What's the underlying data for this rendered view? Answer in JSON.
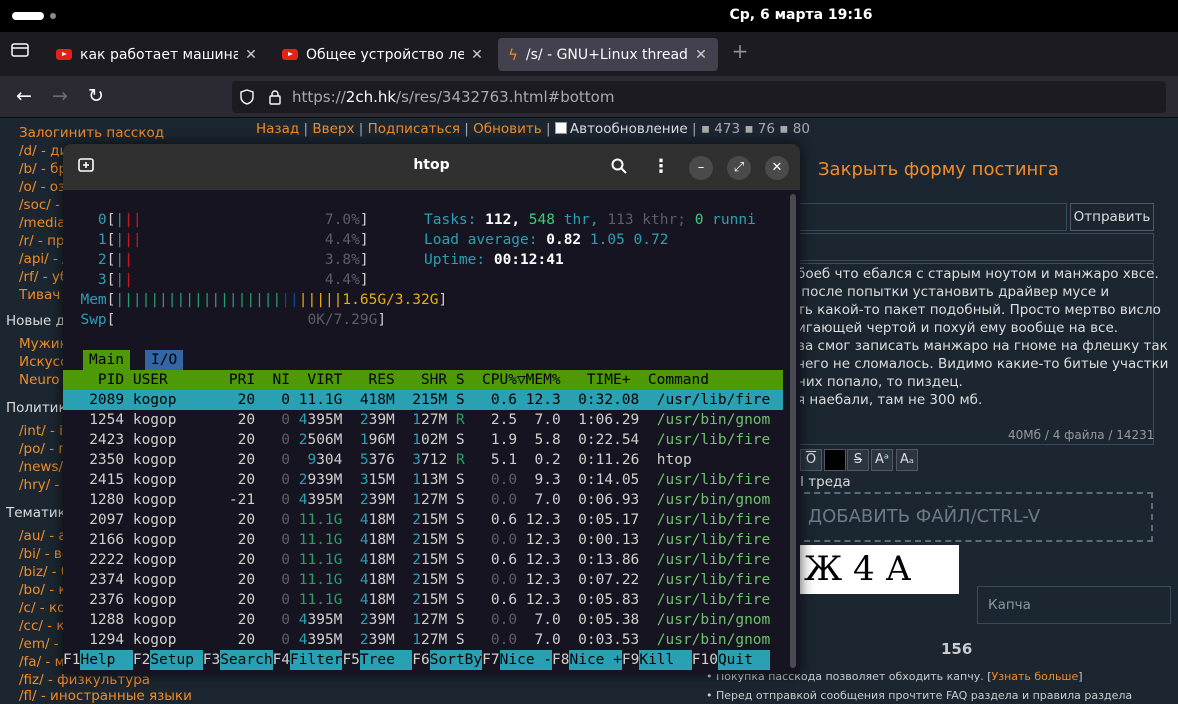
{
  "system": {
    "clock": "Ср, 6 марта  19:16"
  },
  "browser": {
    "tabs": [
      {
        "title": "как работает машина - "
      },
      {
        "title": "Общее устройство легк"
      },
      {
        "title": "/s/ - GNU+Linux thread #"
      }
    ],
    "url_scheme": "https://",
    "url_host": "2ch.hk",
    "url_path": "/s/res/3432763.html#bottom",
    "new_tab": "+"
  },
  "page": {
    "sidebar": [
      "Залогинить пасскод",
      "/d/ - ди",
      "/b/ - бр",
      "/o/ - оз",
      "/soc/ -",
      "/media",
      "/r/ - пр",
      "/api/ - /",
      "/rf/ - уб",
      "Тивач"
    ],
    "sections": [
      "Новые д",
      "Политик",
      "Тематик"
    ],
    "sidebar2": [
      "Мужик",
      "Искусс",
      "Neuro"
    ],
    "sidebar3": [
      "/int/ - i",
      "/po/ - п",
      "/news/",
      "/hry/ -"
    ],
    "sidebar4": [
      "/au/ - а",
      "/bi/ - ве",
      "/biz/ - б",
      "/bo/ - кн",
      "/c/ - ко",
      "/cc/ - к",
      "/em/ - ",
      "/fa/ - м",
      "/fiz/ - физкультура",
      "/fl/ - иностранные языки"
    ],
    "threadnav": {
      "back": "Назад",
      "up": "Вверх",
      "subscribe": "Подписаться",
      "refresh": "Обновить",
      "auto": "Автообновление",
      "stats": "473",
      "stats2": "76",
      "stats3": "80"
    },
    "close_form": "Закрыть форму постинга",
    "send": "Отправить",
    "message": "боеб что ебался с старым ноутом и манжаро хвсе.\n после попытки установить драйвер мусе и\nть какой-то пакет подобный. Просто мертво висло\nигающей чертой и похуй ему вообще на все.\nва смог записать манжаро на гноме на флешку так\nчего не сломалось. Видимо какие-то битые участки\nних попало, то пиздец.\nя наебали, там не 300 мб.",
    "meta": "40Мб / 4 файла / 14231",
    "thread_label": "I треда",
    "dropzone": "ДОБАВИТЬ ФАЙЛ/CTRL-V",
    "captcha_text": "Ж 4 А",
    "captcha_placeholder": "Капча",
    "counter": "156",
    "note1": "• Покупка пасскода позволяет обходить капчу. [",
    "note1_link": "Узнать больше",
    "note1_end": "]",
    "note2": "• Перед отправкой сообщения прочтите FAQ раздела и правила раздела"
  },
  "htop": {
    "title": "htop",
    "cpus": [
      {
        "id": "0",
        "bars": "|||",
        "pct": "7.0%"
      },
      {
        "id": "1",
        "bars": "|||",
        "pct": "4.4%"
      },
      {
        "id": "2",
        "bars": "||",
        "pct": "3.8%"
      },
      {
        "id": "3",
        "bars": "||",
        "pct": "4.4%"
      }
    ],
    "mem": {
      "label": "Mem",
      "bars": "||||||||||||||||||||||||||",
      "value": "1.65G/3.32G"
    },
    "swp": {
      "label": "Swp",
      "value": "0K/7.29G"
    },
    "tasks": {
      "label": "Tasks:",
      "count": "112,",
      "thr_label": "thr,",
      "thr": "548",
      "kthr": "113 kthr;",
      "running": "0",
      "running_label": "runni"
    },
    "load": {
      "label": "Load average:",
      "l1": "0.82",
      "l2": "1.05",
      "l3": "0.72"
    },
    "uptime": {
      "label": "Uptime:",
      "value": "00:12:41"
    },
    "tab_main": "Main",
    "tab_io": "I/O",
    "header": "    PID USER       PRI  NI  VIRT   RES   SHR S  CPU%▽MEM%   TIME+  Command",
    "processes": [
      {
        "pid": "2089",
        "user": "kogop",
        "pri": "20",
        "ni": "0",
        "virt": "11.1G",
        "res": "418M",
        "shr": "215M",
        "s": "S",
        "cpu": "0.6",
        "mem": "12.3",
        "time": "0:32.08",
        "cmd": "/usr/lib/fire"
      },
      {
        "pid": "1254",
        "user": "kogop",
        "pri": "20",
        "ni": "0",
        "virt": "4395M",
        "res": "239M",
        "shr": "127M",
        "s": "R",
        "cpu": "2.5",
        "mem": "7.0",
        "time": "1:06.29",
        "cmd": "/usr/bin/gnom"
      },
      {
        "pid": "2423",
        "user": "kogop",
        "pri": "20",
        "ni": "0",
        "virt": "2506M",
        "res": "196M",
        "shr": "102M",
        "s": "S",
        "cpu": "1.9",
        "mem": "5.8",
        "time": "0:22.54",
        "cmd": "/usr/lib/fire"
      },
      {
        "pid": "2350",
        "user": "kogop",
        "pri": "20",
        "ni": "0",
        "virt": "9304",
        "res": "5376",
        "shr": "3712",
        "s": "R",
        "cpu": "5.1",
        "mem": "0.2",
        "time": "0:11.26",
        "cmd": "htop"
      },
      {
        "pid": "2415",
        "user": "kogop",
        "pri": "20",
        "ni": "0",
        "virt": "2939M",
        "res": "315M",
        "shr": "113M",
        "s": "S",
        "cpu": "0.0",
        "mem": "9.3",
        "time": "0:14.05",
        "cmd": "/usr/lib/fire"
      },
      {
        "pid": "1280",
        "user": "kogop",
        "pri": "-21",
        "ni": "0",
        "virt": "4395M",
        "res": "239M",
        "shr": "127M",
        "s": "S",
        "cpu": "0.0",
        "mem": "7.0",
        "time": "0:06.93",
        "cmd": "/usr/bin/gnom"
      },
      {
        "pid": "2097",
        "user": "kogop",
        "pri": "20",
        "ni": "0",
        "virt": "11.1G",
        "res": "418M",
        "shr": "215M",
        "s": "S",
        "cpu": "0.6",
        "mem": "12.3",
        "time": "0:05.17",
        "cmd": "/usr/lib/fire"
      },
      {
        "pid": "2166",
        "user": "kogop",
        "pri": "20",
        "ni": "0",
        "virt": "11.1G",
        "res": "418M",
        "shr": "215M",
        "s": "S",
        "cpu": "0.0",
        "mem": "12.3",
        "time": "0:00.13",
        "cmd": "/usr/lib/fire"
      },
      {
        "pid": "2222",
        "user": "kogop",
        "pri": "20",
        "ni": "0",
        "virt": "11.1G",
        "res": "418M",
        "shr": "215M",
        "s": "S",
        "cpu": "0.6",
        "mem": "12.3",
        "time": "0:13.86",
        "cmd": "/usr/lib/fire"
      },
      {
        "pid": "2374",
        "user": "kogop",
        "pri": "20",
        "ni": "0",
        "virt": "11.1G",
        "res": "418M",
        "shr": "215M",
        "s": "S",
        "cpu": "0.0",
        "mem": "12.3",
        "time": "0:07.22",
        "cmd": "/usr/lib/fire"
      },
      {
        "pid": "2376",
        "user": "kogop",
        "pri": "20",
        "ni": "0",
        "virt": "11.1G",
        "res": "418M",
        "shr": "215M",
        "s": "S",
        "cpu": "0.6",
        "mem": "12.3",
        "time": "0:05.83",
        "cmd": "/usr/lib/fire"
      },
      {
        "pid": "1288",
        "user": "kogop",
        "pri": "20",
        "ni": "0",
        "virt": "4395M",
        "res": "239M",
        "shr": "127M",
        "s": "S",
        "cpu": "0.0",
        "mem": "7.0",
        "time": "0:05.38",
        "cmd": "/usr/bin/gnom"
      },
      {
        "pid": "1294",
        "user": "kogop",
        "pri": "20",
        "ni": "0",
        "virt": "4395M",
        "res": "239M",
        "shr": "127M",
        "s": "S",
        "cpu": "0.0",
        "mem": "7.0",
        "time": "0:03.53",
        "cmd": "/usr/bin/gnom"
      }
    ],
    "fkeys": [
      {
        "key": "F1",
        "label": "Help  "
      },
      {
        "key": "F2",
        "label": "Setup "
      },
      {
        "key": "F3",
        "label": "Search"
      },
      {
        "key": "F4",
        "label": "Filter"
      },
      {
        "key": "F5",
        "label": "Tree  "
      },
      {
        "key": "F6",
        "label": "SortBy"
      },
      {
        "key": "F7",
        "label": "Nice -"
      },
      {
        "key": "F8",
        "label": "Nice +"
      },
      {
        "key": "F9",
        "label": "Kill  "
      },
      {
        "key": "F10",
        "label": "Quit  "
      }
    ]
  }
}
